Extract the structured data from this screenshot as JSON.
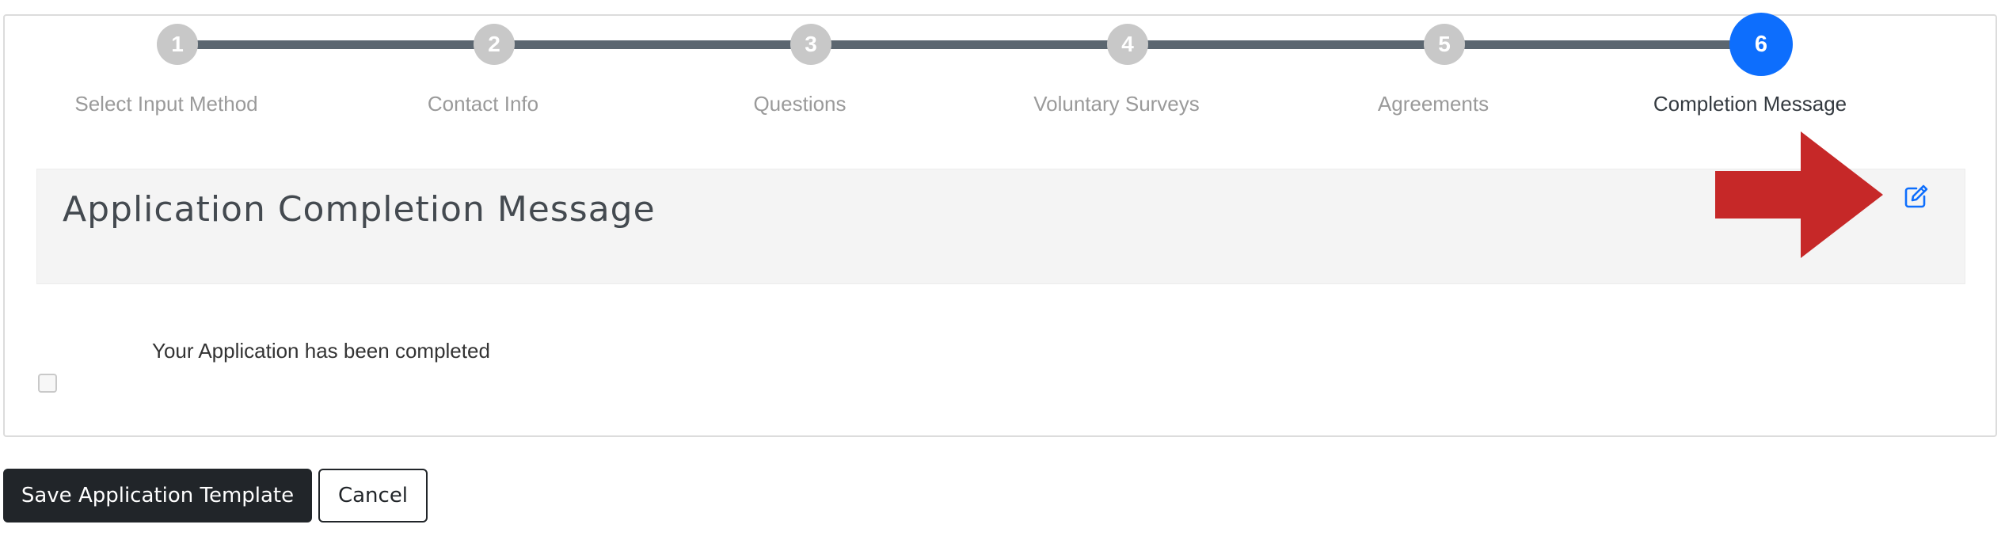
{
  "wizard": {
    "steps": [
      {
        "number": "1",
        "label": "Select Input Method"
      },
      {
        "number": "2",
        "label": "Contact Info"
      },
      {
        "number": "3",
        "label": "Questions"
      },
      {
        "number": "4",
        "label": "Voluntary Surveys"
      },
      {
        "number": "5",
        "label": "Agreements"
      },
      {
        "number": "6",
        "label": "Completion Message"
      }
    ],
    "active_step": 6
  },
  "section": {
    "title": "Application Completion Message",
    "edit_icon": "edit-icon"
  },
  "content": {
    "message": "Your Application has been completed"
  },
  "actions": {
    "save_label": "Save Application Template",
    "cancel_label": "Cancel"
  },
  "colors": {
    "active_step": "#0d6efd",
    "inactive_step": "#c8c8c8",
    "connector": "#5b6670",
    "annotation_arrow": "#c62828"
  }
}
